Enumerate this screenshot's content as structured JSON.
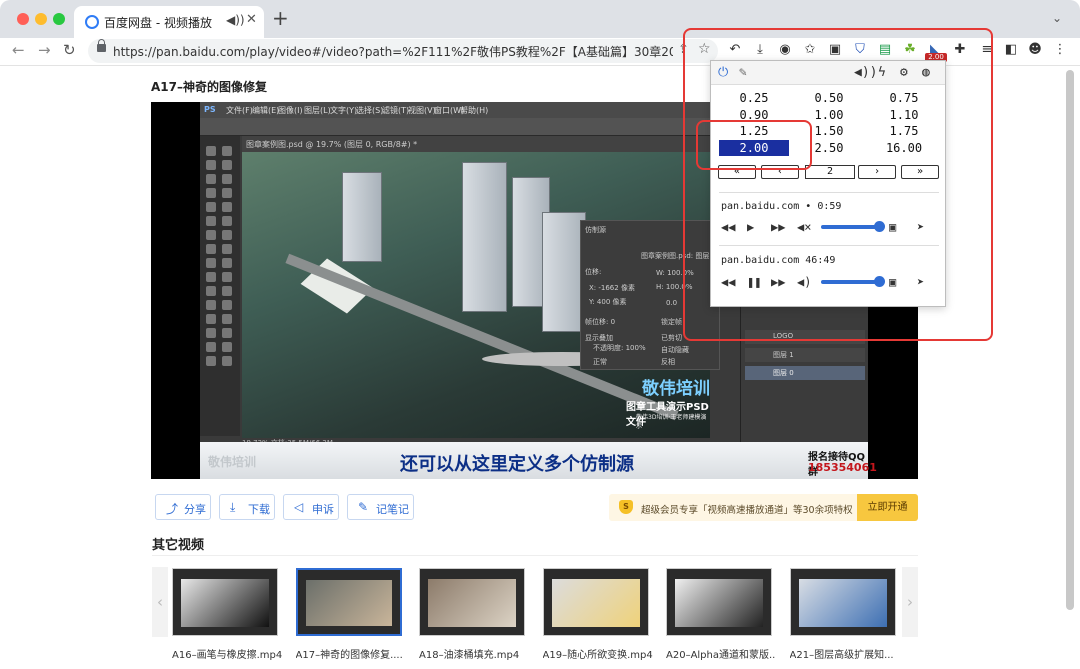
{
  "browser": {
    "tab_title": "百度网盘 - 视频播放",
    "tab_audio_icon": "speaker-icon",
    "new_tab": "+",
    "tab_search": "⌄",
    "url": "https://pan.baidu.com/play/video#/video?path=%2F111%2F敬伟PS教程%2F【A基础篇】30章200节%2FA1...",
    "extension_badge": "2.00"
  },
  "page": {
    "video_title": "A17–神奇的图像修复",
    "section_title": "其它视频",
    "actions": [
      {
        "icon": "share-icon",
        "glyph": "⤴",
        "label": "分享"
      },
      {
        "icon": "download-icon",
        "glyph": "⤓",
        "label": "下载"
      },
      {
        "icon": "megaphone-icon",
        "glyph": "📢",
        "label": "申诉"
      },
      {
        "icon": "note-icon",
        "glyph": "✎",
        "label": "记笔记"
      }
    ],
    "vip": {
      "badge": "S",
      "text": "超级会员专享「视频高速播放通道」等30余项特权",
      "button": "立即开通"
    },
    "thumbnails": [
      {
        "label": "A16–画笔与橡皮擦.mp4",
        "active": false
      },
      {
        "label": "A17–神奇的图像修复....",
        "active": true
      },
      {
        "label": "A18–油漆桶填充.mp4",
        "active": false
      },
      {
        "label": "A19–随心所欲变换.mp4",
        "active": false
      },
      {
        "label": "A20–Alpha通道和蒙版...",
        "active": false
      },
      {
        "label": "A21–图层高级扩展知...",
        "active": false
      }
    ]
  },
  "video": {
    "ps_menus": [
      "PS",
      "文件(F)",
      "编辑(E)",
      "图像(I)",
      "图层(L)",
      "文字(Y)",
      "选择(S)",
      "滤镜(T)",
      "视图(V)",
      "窗口(W)",
      "帮助(H)"
    ],
    "ps_doc_tab": "图章案例图.psd @ 19.7% (图层 0, RGB/8#) *",
    "ps_status": "19.72%      文档:35.5M/66.2M",
    "clone_panel_title": "仿制源",
    "clone_panel_file": "图章案例图.psd: 图层",
    "clone_offset_label": "位移:",
    "clone_x": "X: -1662 像素",
    "clone_y": "Y: 400 像素",
    "clone_w": "W: 100.0%",
    "clone_h": "H: 100.0%",
    "clone_angle": "0.0",
    "clone_frame": "帧位移: 0",
    "clone_lock": "锁定帧",
    "clone_show_overlay": "显示叠加",
    "clone_opacity": "不透明度: 100%",
    "clone_clipped": "已剪切",
    "clone_autohide": "自动隐藏",
    "clone_normal": "正常",
    "clone_invert": "反相",
    "layers": [
      "LOGO",
      "图层 1",
      "图层 0"
    ],
    "watermark_brand": "敬伟培训",
    "watermark_sub": "图章工具演示PSD文件",
    "watermark_sub2": "敬伟3D培训·王老师建模演示",
    "subtitle_logo": "敬伟培训",
    "subtitle": "还可以从这里定义多个仿制源",
    "qq_label": "报名接待QQ群",
    "qq_number": "185354061"
  },
  "popup": {
    "speeds": [
      [
        "0.25",
        "0.50",
        "0.75"
      ],
      [
        "0.90",
        "1.00",
        "1.10"
      ],
      [
        "1.25",
        "1.50",
        "1.75"
      ],
      [
        "2.00",
        "2.50",
        "16.00"
      ]
    ],
    "selected_speed": "2.00",
    "seek_buttons": [
      "«",
      "‹",
      "›",
      "»"
    ],
    "seek_value": "2",
    "media": [
      {
        "title": "pan.baidu.com • 0:59",
        "playing": false,
        "volume": 0.0,
        "volume_fraction": 0.95
      },
      {
        "title": "pan.baidu.com 46:49",
        "playing": true,
        "volume_fraction": 0.95
      }
    ]
  },
  "colors": {
    "accent": "#2f6cd3",
    "highlight": "#e53935",
    "speed_selected": "#1a2fa0",
    "vip_button": "#f7c73f"
  }
}
